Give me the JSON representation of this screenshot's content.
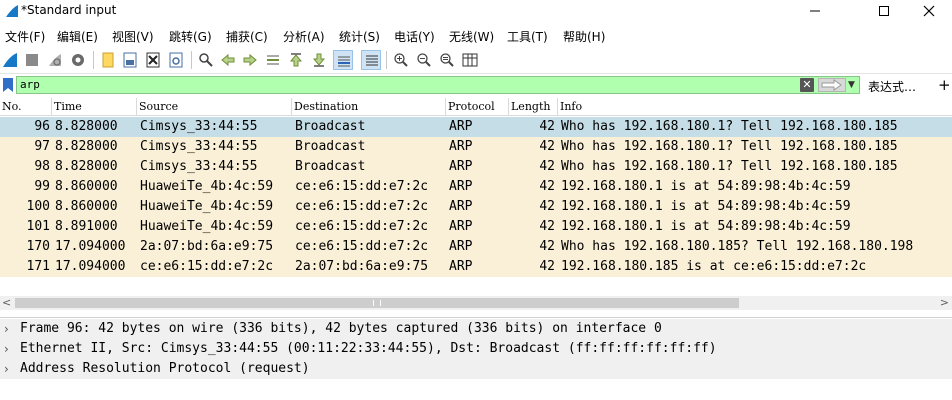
{
  "window": {
    "title": "*Standard input",
    "controls": [
      "minimize",
      "maximize",
      "close"
    ]
  },
  "menu": [
    {
      "label": "文件(F)"
    },
    {
      "label": "编辑(E)"
    },
    {
      "label": "视图(V)"
    },
    {
      "label": "跳转(G)"
    },
    {
      "label": "捕获(C)"
    },
    {
      "label": "分析(A)"
    },
    {
      "label": "统计(S)"
    },
    {
      "label": "电话(Y)"
    },
    {
      "label": "无线(W)"
    },
    {
      "label": "工具(T)"
    },
    {
      "label": "帮助(H)"
    }
  ],
  "filter": {
    "value": "arp",
    "expression_label": "表达式…",
    "add_label": "+",
    "background_color": "#afffaf"
  },
  "columns": [
    "No.",
    "Time",
    "Source",
    "Destination",
    "Protocol",
    "Length",
    "Info"
  ],
  "packets": [
    {
      "no": "96",
      "time": "8.828000",
      "source": "Cimsys_33:44:55",
      "destination": "Broadcast",
      "protocol": "ARP",
      "length": "42",
      "info": "Who has 192.168.180.1? Tell 192.168.180.185",
      "selected": true
    },
    {
      "no": "97",
      "time": "8.828000",
      "source": "Cimsys_33:44:55",
      "destination": "Broadcast",
      "protocol": "ARP",
      "length": "42",
      "info": "Who has 192.168.180.1? Tell 192.168.180.185",
      "selected": false
    },
    {
      "no": "98",
      "time": "8.828000",
      "source": "Cimsys_33:44:55",
      "destination": "Broadcast",
      "protocol": "ARP",
      "length": "42",
      "info": "Who has 192.168.180.1? Tell 192.168.180.185",
      "selected": false
    },
    {
      "no": "99",
      "time": "8.860000",
      "source": "HuaweiTe_4b:4c:59",
      "destination": "ce:e6:15:dd:e7:2c",
      "protocol": "ARP",
      "length": "42",
      "info": "192.168.180.1 is at 54:89:98:4b:4c:59",
      "selected": false
    },
    {
      "no": "100",
      "time": "8.860000",
      "source": "HuaweiTe_4b:4c:59",
      "destination": "ce:e6:15:dd:e7:2c",
      "protocol": "ARP",
      "length": "42",
      "info": "192.168.180.1 is at 54:89:98:4b:4c:59",
      "selected": false
    },
    {
      "no": "101",
      "time": "8.891000",
      "source": "HuaweiTe_4b:4c:59",
      "destination": "ce:e6:15:dd:e7:2c",
      "protocol": "ARP",
      "length": "42",
      "info": "192.168.180.1 is at 54:89:98:4b:4c:59",
      "selected": false
    },
    {
      "no": "170",
      "time": "17.094000",
      "source": "2a:07:bd:6a:e9:75",
      "destination": "ce:e6:15:dd:e7:2c",
      "protocol": "ARP",
      "length": "42",
      "info": "Who has 192.168.180.185? Tell 192.168.180.198",
      "selected": false
    },
    {
      "no": "171",
      "time": "17.094000",
      "source": "ce:e6:15:dd:e7:2c",
      "destination": "2a:07:bd:6a:e9:75",
      "protocol": "ARP",
      "length": "42",
      "info": "192.168.180.185 is at ce:e6:15:dd:e7:2c",
      "selected": false
    }
  ],
  "row_colors": {
    "arp": "#faf0d7",
    "selected": "#c5dde6"
  },
  "details": [
    {
      "text": "Frame 96: 42 bytes on wire (336 bits), 42 bytes captured (336 bits) on interface 0"
    },
    {
      "text": "Ethernet II, Src: Cimsys_33:44:55 (00:11:22:33:44:55), Dst: Broadcast (ff:ff:ff:ff:ff:ff)"
    },
    {
      "text": "Address Resolution Protocol (request)"
    }
  ],
  "toolbar_icons": [
    "start-capture-icon",
    "stop-capture-icon",
    "restart-capture-icon",
    "capture-options-icon",
    "open-file-icon",
    "save-file-icon",
    "close-file-icon",
    "reload-file-icon",
    "find-packet-icon",
    "go-back-icon",
    "go-forward-icon",
    "go-to-packet-icon",
    "go-first-icon",
    "go-last-icon",
    "auto-scroll-icon",
    "colorize-icon",
    "zoom-in-icon",
    "zoom-out-icon",
    "zoom-normal-icon",
    "resize-columns-icon"
  ]
}
